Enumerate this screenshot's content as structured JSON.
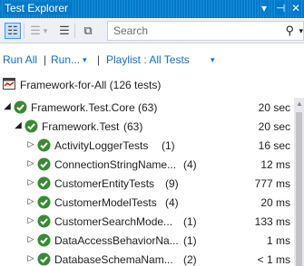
{
  "window": {
    "title": "Test Explorer",
    "controls": {
      "dropdown": "▾",
      "pin": "⊣",
      "close": "✕"
    }
  },
  "toolbar": {
    "buttons": [
      {
        "name": "group-by-icon",
        "glyph": "☷"
      },
      {
        "name": "group-by-disabled-icon",
        "glyph": "☰"
      },
      {
        "name": "collapse-all-icon",
        "glyph": "☰"
      },
      {
        "name": "new-window-icon",
        "glyph": "⧉"
      }
    ],
    "search": {
      "placeholder": "Search",
      "value": "",
      "icon": "⚲",
      "caret": "▾"
    }
  },
  "runbar": {
    "run_all": "Run All",
    "sep1": "|",
    "run": "Run...",
    "run_caret": "▾",
    "sep2": "|",
    "playlist": "Playlist : All Tests",
    "playlist_caret": "▾"
  },
  "summary": {
    "label": "Framework-for-All (126 tests)"
  },
  "tree": {
    "rows": [
      {
        "expander": "◢",
        "name": "Framework.Test.Core",
        "count": "(63)",
        "duration": "20 sec"
      },
      {
        "expander": "◢",
        "name": "Framework.Test",
        "count": "(63)",
        "duration": "20 sec"
      },
      {
        "expander": "▷",
        "name": "ActivityLoggerTests",
        "count": "(1)",
        "duration": "16 sec"
      },
      {
        "expander": "▷",
        "name": "ConnectionStringName...",
        "count": "(4)",
        "duration": "12 ms"
      },
      {
        "expander": "▷",
        "name": "CustomerEntityTests",
        "count": "(9)",
        "duration": "777 ms"
      },
      {
        "expander": "▷",
        "name": "CustomerModelTests",
        "count": "(4)",
        "duration": "20 ms"
      },
      {
        "expander": "▷",
        "name": "CustomerSearchMode...",
        "count": "(1)",
        "duration": "133 ms"
      },
      {
        "expander": "▷",
        "name": "DataAccessBehaviorNa...",
        "count": "(1)",
        "duration": "1 ms"
      },
      {
        "expander": "▷",
        "name": "DatabaseSchemaNam...",
        "count": "(2)",
        "duration": "< 1 ms"
      }
    ]
  },
  "colors": {
    "titlebar": "#007acc",
    "link": "#0e70c0",
    "passed": "#388a34",
    "toolbar_bg": "#eef0f5"
  },
  "scrollbar": {
    "up_arrow": "▲"
  }
}
